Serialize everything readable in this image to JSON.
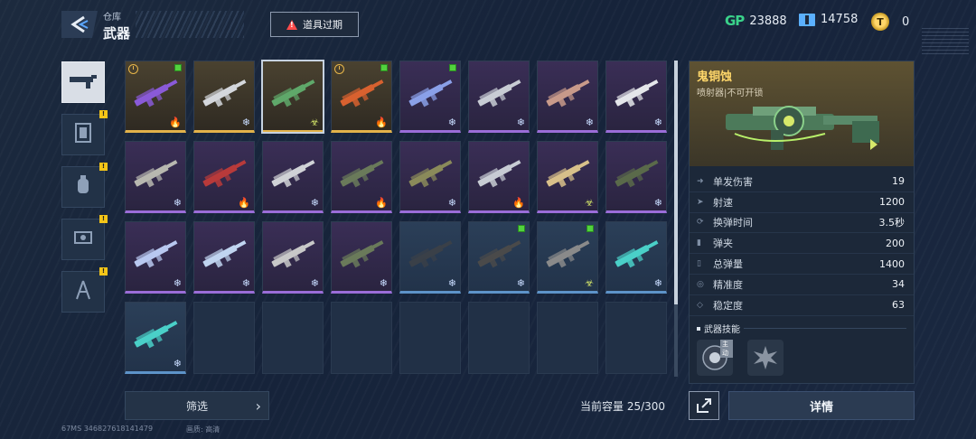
{
  "header": {
    "crumb_small": "仓库",
    "crumb_big": "武器",
    "expire_label": "道具过期"
  },
  "currency": {
    "gp_label": "GP",
    "gp": "23888",
    "ticket": "14758",
    "coin_symbol": "T",
    "coin": "0"
  },
  "sidebar": {
    "tabs": [
      {
        "icon": "weapon-tab-icon",
        "active": true,
        "badge": false
      },
      {
        "icon": "armor-tab-icon",
        "active": false,
        "badge": true
      },
      {
        "icon": "grenade-tab-icon",
        "active": false,
        "badge": true
      },
      {
        "icon": "drone-tab-icon",
        "active": false,
        "badge": true
      },
      {
        "icon": "character-tab-icon",
        "active": false,
        "badge": true
      }
    ],
    "badge_mark": "!"
  },
  "colors": {
    "purple": "#9a6dd8",
    "gold": "#e2b24a",
    "blue": "#5d93c9",
    "accent_yellow": "#ffd76a"
  },
  "grid": {
    "slots": [
      {
        "rarity": "gold",
        "clock": true,
        "new": true,
        "elem": "fire",
        "gun": "#8a5ad8"
      },
      {
        "rarity": "gold",
        "clock": false,
        "new": false,
        "elem": "ice",
        "gun": "#d4d7dc"
      },
      {
        "rarity": "gold",
        "clock": false,
        "new": false,
        "elem": "acid",
        "gun": "#5fa86a",
        "selected": true
      },
      {
        "rarity": "gold",
        "clock": true,
        "new": true,
        "elem": "fire",
        "gun": "#d8612f"
      },
      {
        "rarity": "purple",
        "clock": false,
        "new": true,
        "elem": "ice",
        "gun": "#8aa0e8"
      },
      {
        "rarity": "purple",
        "clock": false,
        "new": false,
        "elem": "ice",
        "gun": "#c8ccd4"
      },
      {
        "rarity": "purple",
        "clock": false,
        "new": false,
        "elem": "ice",
        "gun": "#c89a8a"
      },
      {
        "rarity": "purple",
        "clock": false,
        "new": false,
        "elem": "ice",
        "gun": "#e4e6ea"
      },
      {
        "rarity": "purple",
        "clock": false,
        "new": false,
        "elem": "ice",
        "gun": "#b8b8b0"
      },
      {
        "rarity": "purple",
        "clock": false,
        "new": false,
        "elem": "fire",
        "gun": "#b83a3a"
      },
      {
        "rarity": "purple",
        "clock": false,
        "new": false,
        "elem": "ice",
        "gun": "#d0d2d6"
      },
      {
        "rarity": "purple",
        "clock": false,
        "new": false,
        "elem": "fire",
        "gun": "#6a7a5a"
      },
      {
        "rarity": "purple",
        "clock": false,
        "new": false,
        "elem": "ice",
        "gun": "#8a8a5a"
      },
      {
        "rarity": "purple",
        "clock": false,
        "new": false,
        "elem": "fire",
        "gun": "#c8ccd4"
      },
      {
        "rarity": "purple",
        "clock": false,
        "new": false,
        "elem": "acid",
        "gun": "#d8c08a"
      },
      {
        "rarity": "purple",
        "clock": false,
        "new": false,
        "elem": "ice",
        "gun": "#5a6a4a"
      },
      {
        "rarity": "purple",
        "clock": false,
        "new": false,
        "elem": "ice",
        "gun": "#b8c8f0"
      },
      {
        "rarity": "purple",
        "clock": false,
        "new": false,
        "elem": "ice",
        "gun": "#c0d4f0"
      },
      {
        "rarity": "purple",
        "clock": false,
        "new": false,
        "elem": "ice",
        "gun": "#c8c8c8"
      },
      {
        "rarity": "purple",
        "clock": false,
        "new": false,
        "elem": "ice",
        "gun": "#6a7a5a"
      },
      {
        "rarity": "blue",
        "clock": false,
        "new": false,
        "elem": "ice",
        "gun": "#3a4048"
      },
      {
        "rarity": "blue",
        "clock": false,
        "new": true,
        "elem": "ice",
        "gun": "#4a4a4a"
      },
      {
        "rarity": "blue",
        "clock": false,
        "new": true,
        "elem": "acid",
        "gun": "#8a8a8a"
      },
      {
        "rarity": "blue",
        "clock": false,
        "new": false,
        "elem": "ice",
        "gun": "#4ad0c8"
      },
      {
        "rarity": "blue",
        "clock": false,
        "new": false,
        "elem": "ice",
        "gun": "#4ad0c8"
      }
    ],
    "total_slots": 32
  },
  "filter": {
    "label": "筛选"
  },
  "capacity": {
    "label": "当前容量 25/300"
  },
  "detail": {
    "name": "鬼铜蚀",
    "subtitle": "喷射器|不可开锁",
    "stats": [
      {
        "label": "单发伤害",
        "value": "19"
      },
      {
        "label": "射速",
        "value": "1200"
      },
      {
        "label": "换弹时间",
        "value": "3.5秒"
      },
      {
        "label": "弹夹",
        "value": "200"
      },
      {
        "label": "总弹量",
        "value": "1400"
      },
      {
        "label": "精准度",
        "value": "34"
      },
      {
        "label": "稳定度",
        "value": "63"
      }
    ],
    "skill_title": "武器技能",
    "skill_tag": "主动",
    "detail_button": "详情"
  },
  "footer": {
    "ping": "67MS  346827618141479",
    "quality": "画质: 高清"
  }
}
